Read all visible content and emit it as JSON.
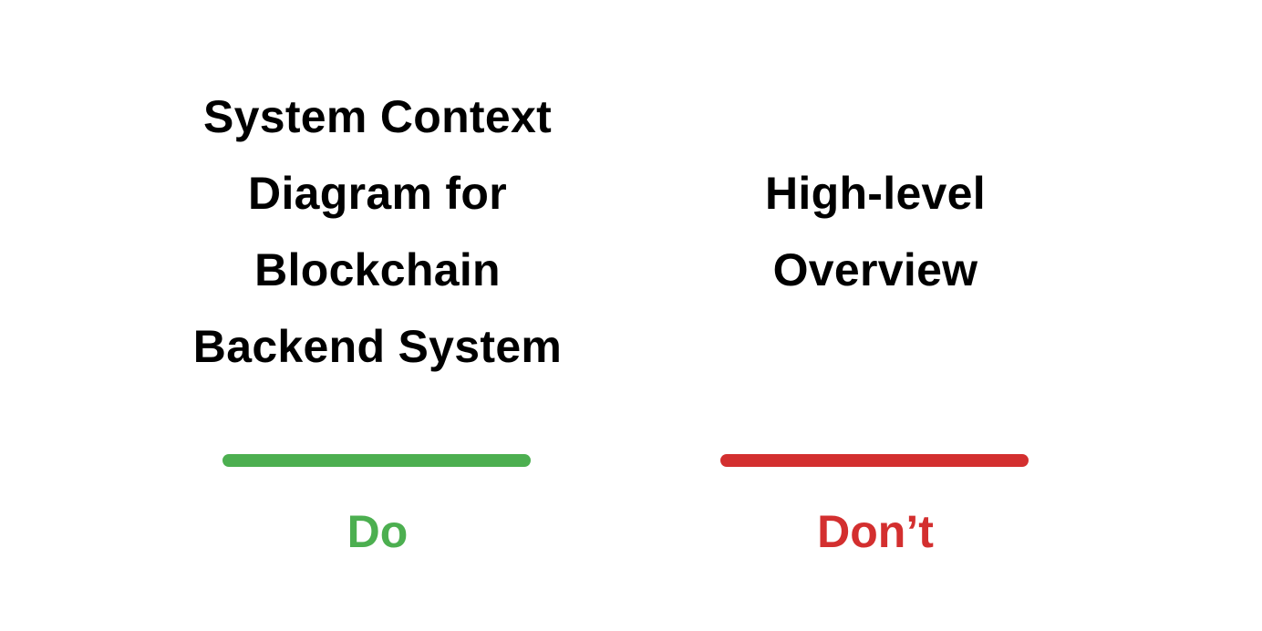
{
  "do": {
    "phrase_lines": [
      "System Context",
      "Diagram for",
      "Blockchain",
      "Backend System"
    ],
    "label": "Do",
    "color": "#4caf50"
  },
  "dont": {
    "phrase_lines": [
      "High-level",
      "Overview"
    ],
    "label": "Don’t",
    "color": "#d32f2f"
  }
}
